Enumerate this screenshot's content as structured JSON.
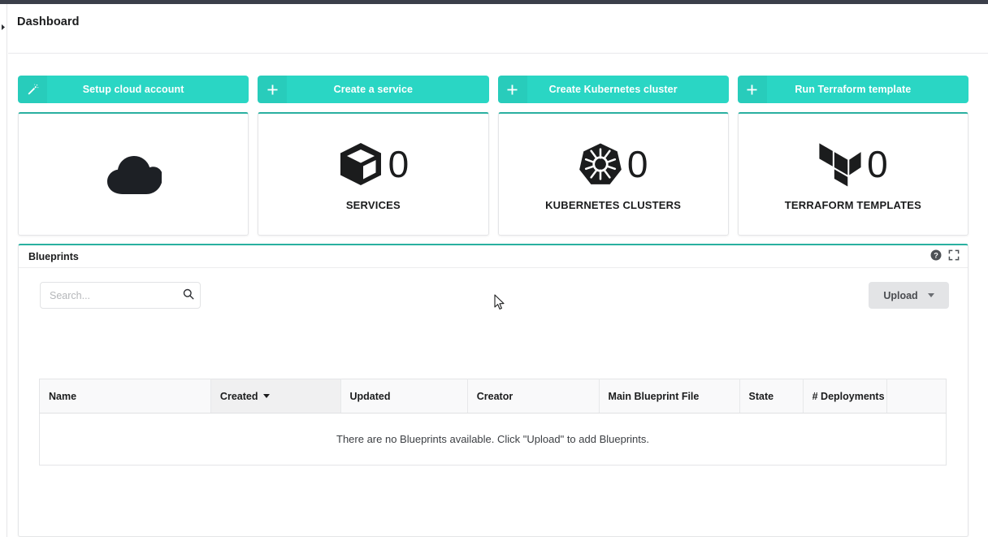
{
  "header": {
    "title": "Dashboard",
    "rail_toggle_icon": "chevron-right-icon"
  },
  "actions": [
    {
      "label": "Setup cloud account",
      "icon": "magic-wand-icon"
    },
    {
      "label": "Create a service",
      "icon": "plus-icon"
    },
    {
      "label": "Create Kubernetes cluster",
      "icon": "plus-icon"
    },
    {
      "label": "Run Terraform template",
      "icon": "plus-icon"
    }
  ],
  "stat_cards": [
    {
      "icon": "cloud-icon",
      "count": "",
      "label": ""
    },
    {
      "icon": "cube-icon",
      "count": "0",
      "label": "SERVICES"
    },
    {
      "icon": "kubernetes-icon",
      "count": "0",
      "label": "KUBERNETES CLUSTERS"
    },
    {
      "icon": "terraform-icon",
      "count": "0",
      "label": "TERRAFORM TEMPLATES"
    }
  ],
  "blueprints": {
    "panel_title": "Blueprints",
    "tools": [
      {
        "name": "help-icon"
      },
      {
        "name": "expand-icon"
      }
    ],
    "search": {
      "placeholder": "Search...",
      "value": "",
      "icon": "search-icon"
    },
    "upload": {
      "label": "Upload",
      "caret_icon": "chevron-down-icon"
    },
    "table": {
      "columns": [
        {
          "label": "Name",
          "sorted": false
        },
        {
          "label": "Created",
          "sorted": true,
          "direction": "desc"
        },
        {
          "label": "Updated",
          "sorted": false
        },
        {
          "label": "Creator",
          "sorted": false
        },
        {
          "label": "Main Blueprint File",
          "sorted": false
        },
        {
          "label": "State",
          "sorted": false
        },
        {
          "label": "# Deployments",
          "sorted": false
        },
        {
          "label": "",
          "sorted": false
        }
      ],
      "rows": [],
      "empty_message": "There are no Blueprints available. Click \"Upload\" to add Blueprints."
    }
  },
  "colors": {
    "topbar": "#3b3f4a",
    "accent_teal": "#2ad6c4",
    "card_top_border": "#2ab0a0",
    "upload_grey": "#e3e4e6",
    "text_dark": "#1b1c1d"
  }
}
